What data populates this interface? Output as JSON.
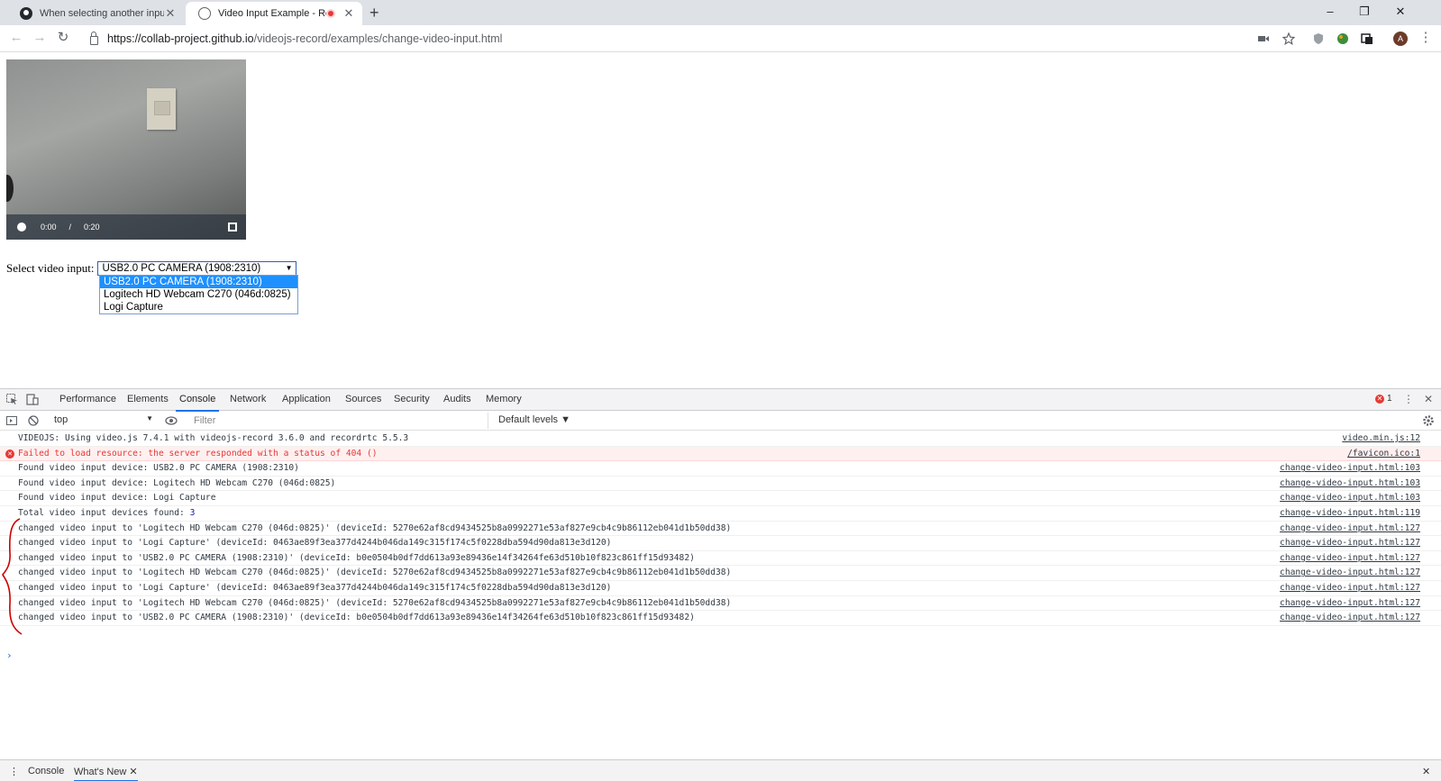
{
  "browser": {
    "tabs": [
      {
        "title": "When selecting another input de",
        "favicon": "github-icon"
      },
      {
        "title": "Video Input Example - Recor",
        "favicon": "globe-icon",
        "recording": true
      }
    ],
    "new_tab": "+",
    "window_controls": {
      "minimize": "–",
      "restore": "❐",
      "close": "✕"
    },
    "url": {
      "scheme": "https://",
      "host": "collab-project.github.io",
      "path": "/videojs-record/examples/change-video-input.html"
    },
    "avatar_initial": "A"
  },
  "player": {
    "current_time": "0:00",
    "separator": "/",
    "duration": "0:20"
  },
  "video_select": {
    "label": "Select video input:",
    "selected": "USB2.0 PC CAMERA (1908:2310)",
    "options": [
      "USB2.0 PC CAMERA (1908:2310)",
      "Logitech HD Webcam C270 (046d:0825)",
      "Logi Capture"
    ]
  },
  "devtools": {
    "tabs": [
      "Performance",
      "Elements",
      "Console",
      "Network",
      "Application",
      "Sources",
      "Security",
      "Audits",
      "Memory"
    ],
    "active_tab": "Console",
    "error_count": "1",
    "context": "top",
    "filter_placeholder": "Filter",
    "levels": "Default levels ▼",
    "console_rows": [
      {
        "text": "VIDEOJS: Using video.js 7.4.1 with videojs-record 3.6.0 and recordrtc 5.5.3",
        "src": "video.min.js:12",
        "type": "log"
      },
      {
        "text": "Failed to load resource: the server responded with a status of 404 ()",
        "src": "/favicon.ico:1",
        "type": "error"
      },
      {
        "text": "Found video input device:  USB2.0 PC CAMERA (1908:2310)",
        "src": "change-video-input.html:103",
        "type": "log"
      },
      {
        "text": "Found video input device:  Logitech HD Webcam C270 (046d:0825)",
        "src": "change-video-input.html:103",
        "type": "log"
      },
      {
        "text": "Found video input device:  Logi Capture",
        "src": "change-video-input.html:103",
        "type": "log"
      },
      {
        "text": "Total video input devices found: ",
        "num": "3",
        "src": "change-video-input.html:119",
        "type": "log"
      },
      {
        "text": "changed video input to 'Logitech HD Webcam C270 (046d:0825)' (deviceId: 5270e62af8cd9434525b8a0992271e53af827e9cb4c9b86112eb041d1b50dd38)",
        "src": "change-video-input.html:127",
        "type": "log"
      },
      {
        "text": "changed video input to 'Logi Capture' (deviceId: 0463ae89f3ea377d4244b046da149c315f174c5f0228dba594d90da813e3d120)",
        "src": "change-video-input.html:127",
        "type": "log"
      },
      {
        "text": "changed video input to 'USB2.0 PC CAMERA (1908:2310)' (deviceId: b0e0504b0df7dd613a93e89436e14f34264fe63d510b10f823c861ff15d93482)",
        "src": "change-video-input.html:127",
        "type": "log"
      },
      {
        "text": "changed video input to 'Logitech HD Webcam C270 (046d:0825)' (deviceId: 5270e62af8cd9434525b8a0992271e53af827e9cb4c9b86112eb041d1b50dd38)",
        "src": "change-video-input.html:127",
        "type": "log"
      },
      {
        "text": "changed video input to 'Logi Capture' (deviceId: 0463ae89f3ea377d4244b046da149c315f174c5f0228dba594d90da813e3d120)",
        "src": "change-video-input.html:127",
        "type": "log"
      },
      {
        "text": "changed video input to 'Logitech HD Webcam C270 (046d:0825)' (deviceId: 5270e62af8cd9434525b8a0992271e53af827e9cb4c9b86112eb041d1b50dd38)",
        "src": "change-video-input.html:127",
        "type": "log"
      },
      {
        "text": "changed video input to 'USB2.0 PC CAMERA (1908:2310)' (deviceId: b0e0504b0df7dd613a93e89436e14f34264fe63d510b10f823c861ff15d93482)",
        "src": "change-video-input.html:127",
        "type": "log"
      }
    ],
    "prompt": "›",
    "drawer": {
      "tabs": [
        "Console",
        "What's New"
      ],
      "active": "What's New",
      "close": "✕"
    }
  },
  "colors": {
    "accent": "#1a73e8",
    "error": "#e53935",
    "annotation": "#cc0000",
    "selection": "#1e90ff"
  }
}
